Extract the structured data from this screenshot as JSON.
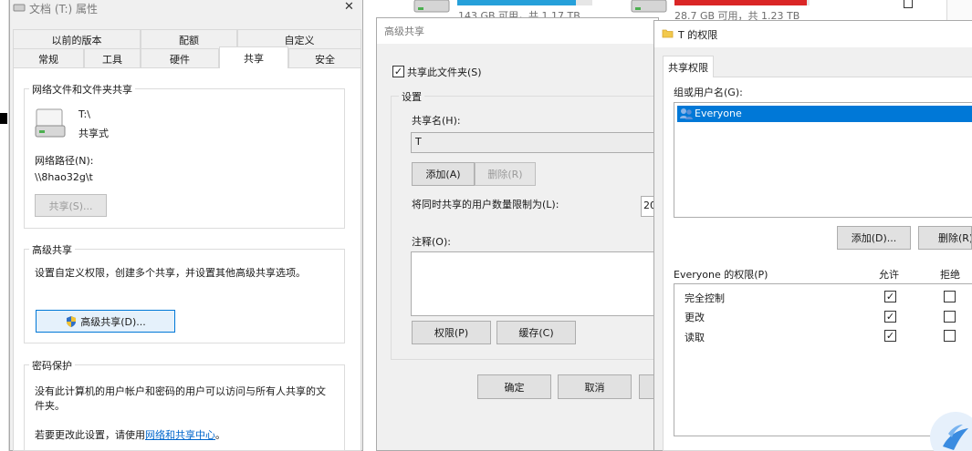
{
  "drives": [
    {
      "usage": "143 GB 可用，共 1.17 TB",
      "bar_color": "#26a0da",
      "fill_fraction": 0.88
    },
    {
      "usage": "28.7 GB 可用，共 1.23 TB",
      "bar_color": "#da2626",
      "fill_fraction": 0.98
    }
  ],
  "properties": {
    "title": "文档 (T:) 属性",
    "close_glyph": "✕",
    "tabs_row1": [
      "以前的版本",
      "配额",
      "自定义"
    ],
    "tabs_row2": [
      "常规",
      "工具",
      "硬件",
      "共享",
      "安全"
    ],
    "active_tab": "共享",
    "network_group": {
      "title": "网络文件和文件夹共享",
      "drive_name": "T:\\",
      "share_state": "共享式",
      "path_label": "网络路径(N):",
      "path_value": "\\\\8hao32g\\t",
      "share_button": "共享(S)..."
    },
    "advanced_group": {
      "title": "高级共享",
      "description": "设置自定义权限，创建多个共享，并设置其他高级共享选项。",
      "button": "高级共享(D)..."
    },
    "password_group": {
      "title": "密码保护",
      "line1": "没有此计算机的用户帐户和密码的用户可以访问与所有人共享的文",
      "line2": "件夹。",
      "change_prefix": "若要更改此设置，请使用",
      "link": "网络和共享中心",
      "change_suffix": "。"
    }
  },
  "advanced_sharing": {
    "title": "高级共享",
    "share_checkbox": "共享此文件夹(S)",
    "share_checked": "✓",
    "settings_title": "设置",
    "share_name_label": "共享名(H):",
    "share_name_value": "T",
    "add_button": "添加(A)",
    "remove_button": "删除(R)",
    "limit_label": "将同时共享的用户数量限制为(L):",
    "limit_value": "20",
    "comment_label": "注释(O):",
    "permissions_button": "权限(P)",
    "cache_button": "缓存(C)",
    "ok_button": "确定",
    "cancel_button": "取消"
  },
  "permissions": {
    "title": "T 的权限",
    "tab": "共享权限",
    "group_label": "组或用户名(G):",
    "users": [
      "Everyone"
    ],
    "add_button": "添加(D)...",
    "remove_button": "删除(R)",
    "perm_header": "Everyone 的权限(P)",
    "allow_header": "允许",
    "deny_header": "拒绝",
    "rows": [
      {
        "name": "完全控制",
        "allow": "✓",
        "deny": ""
      },
      {
        "name": "更改",
        "allow": "✓",
        "deny": ""
      },
      {
        "name": "读取",
        "allow": "✓",
        "deny": ""
      }
    ]
  }
}
